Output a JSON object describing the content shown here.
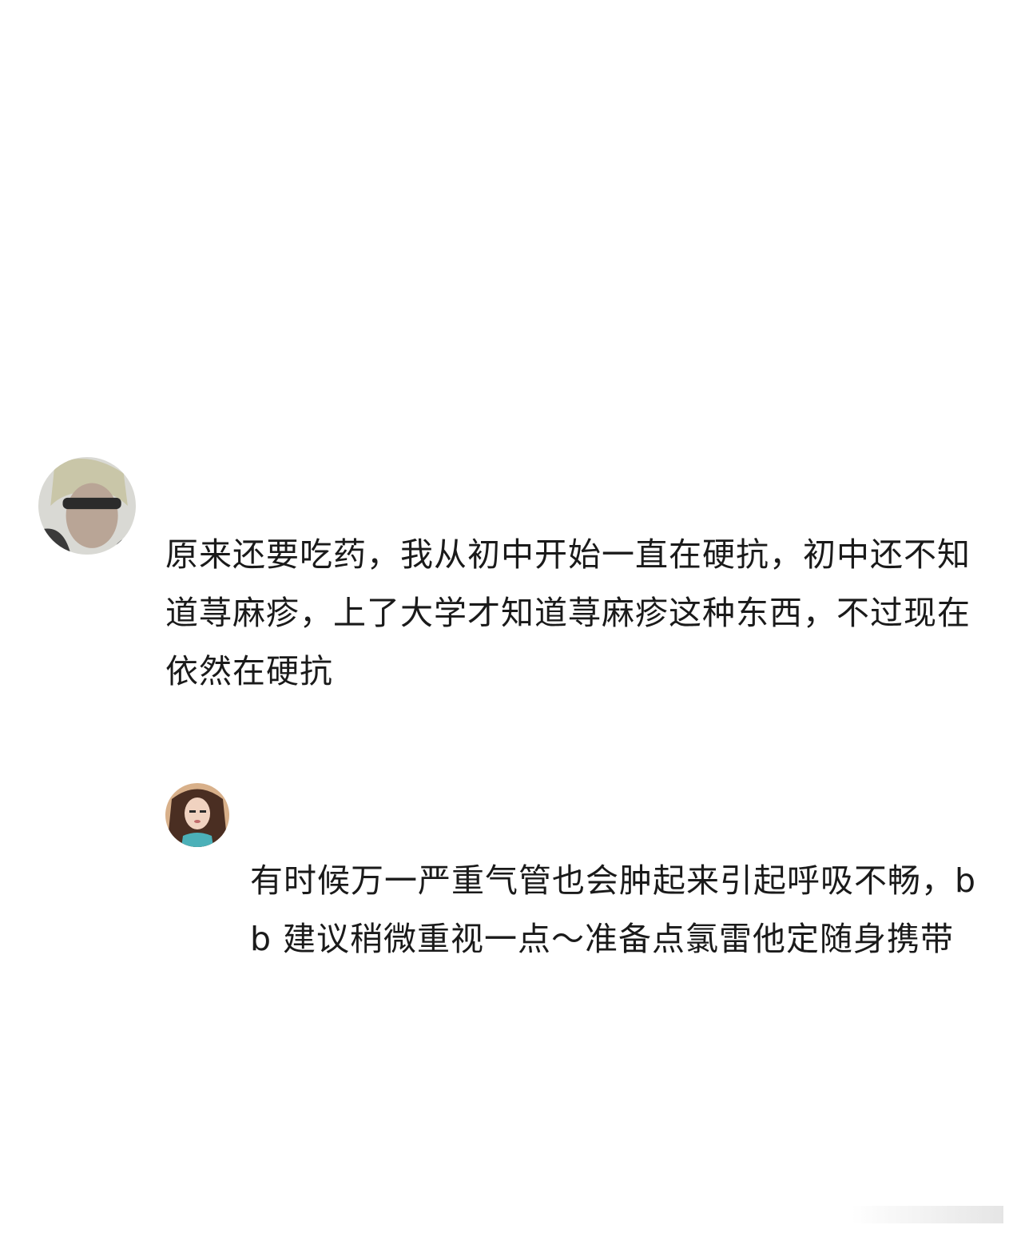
{
  "comments": [
    {
      "avatar_icon": "user-avatar-icon",
      "text": "原来还要吃药，我从初中开始一直在硬抗，初中还不知道荨麻疹，上了大学才知道荨麻疹这种东西，不过现在依然在硬抗"
    },
    {
      "avatar_icon": "user-avatar-icon",
      "text": "有时候万一严重气管也会肿起来引起呼吸不畅，bb 建议稍微重视一点～准备点氯雷他定随身携带"
    }
  ]
}
